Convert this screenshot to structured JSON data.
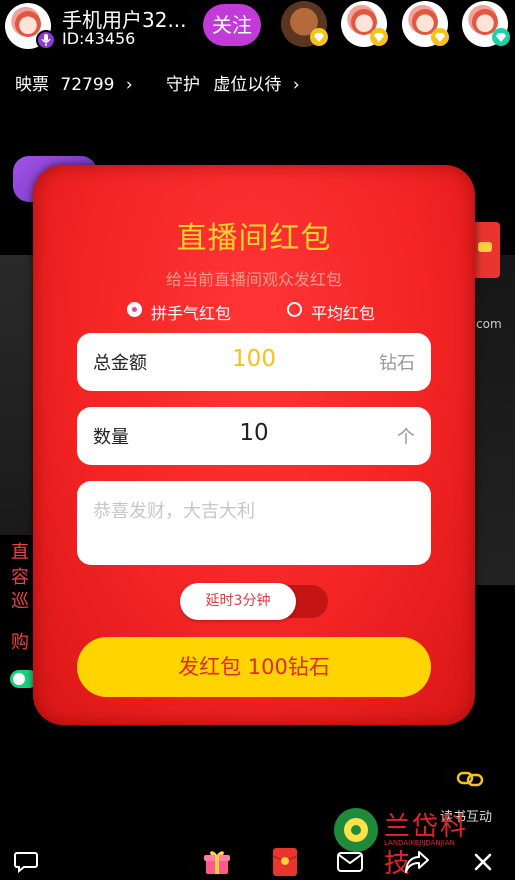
{
  "host": {
    "name": "手机用户32...",
    "id": "ID:43456",
    "follow_label": "关注"
  },
  "stats": {
    "tickets_label": "映票",
    "tickets_value": "72799",
    "guard_label": "守护",
    "guard_value": "虚位以待"
  },
  "background_text": {
    "left_lines": [
      "直",
      "容",
      "巡",
      "购"
    ],
    "url_fragment": "com"
  },
  "modal": {
    "title": "直播间红包",
    "subtitle": "给当前直播间观众发红包",
    "options": [
      {
        "label": "拼手气红包",
        "selected": true
      },
      {
        "label": "平均红包",
        "selected": false
      }
    ],
    "amount": {
      "label": "总金额",
      "value": "100",
      "unit": "钻石",
      "value_color": "#f6c21c"
    },
    "quantity": {
      "label": "数量",
      "value": "10",
      "unit": "个"
    },
    "message": {
      "placeholder": "恭喜发财，大吉大利"
    },
    "delay_toggle": {
      "label": "延时3分钟",
      "enabled": false
    },
    "send_label": "发红包 100钻石"
  },
  "bottom": {
    "interact_label": "读书互动"
  },
  "watermark": {
    "text": "兰岱科技",
    "pinyin": "LANDAIKEJIJDANJIAN"
  },
  "colors": {
    "modal_red": "#f32424",
    "title_gold": "#ffd22e",
    "send_yellow": "#ffd400",
    "follow_purple": "#c23ad8"
  }
}
